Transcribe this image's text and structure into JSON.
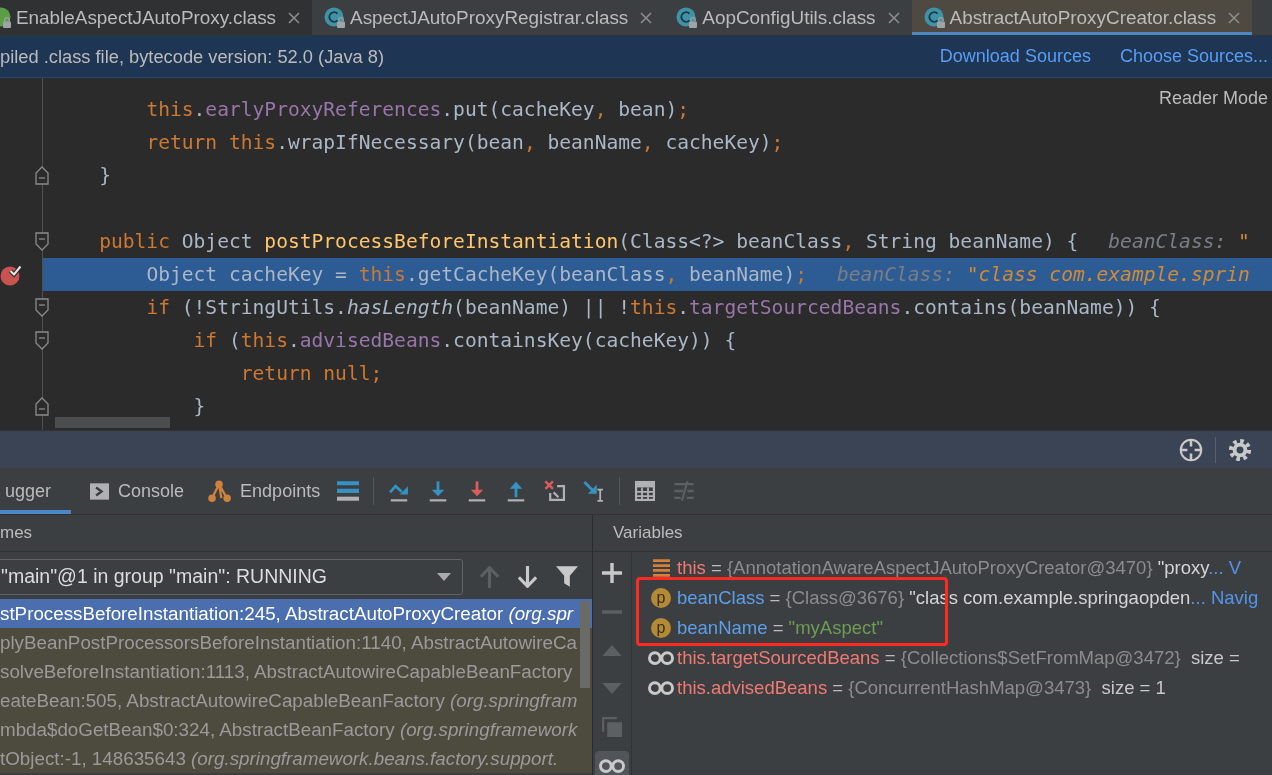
{
  "editor_tabs": [
    {
      "label": "EnableAspectJAutoProxy.class",
      "kind": "annotation",
      "selected": false,
      "hovered": true
    },
    {
      "label": "AspectJAutoProxyRegistrar.class",
      "kind": "class",
      "selected": false,
      "hovered": false
    },
    {
      "label": "AopConfigUtils.class",
      "kind": "class",
      "selected": false,
      "hovered": false
    },
    {
      "label": "AbstractAutoProxyCreator.class",
      "kind": "class",
      "selected": true,
      "hovered": false
    }
  ],
  "banner": {
    "message": "piled .class file, bytecode version: 52.0 (Java 8)",
    "links": [
      "Download Sources",
      "Choose Sources..."
    ]
  },
  "editor": {
    "reader_mode": "Reader Mode",
    "lines": [
      {
        "breakpoint": false,
        "current": false,
        "fold_start": false,
        "fold_end": false,
        "tokens": [
          {
            "text": "        this",
            "kind": "keyword"
          },
          {
            "text": ".earlyProxyReferences",
            "kind": "member"
          },
          {
            "text": ".put(cacheKey",
            "kind": "plain"
          },
          {
            "text": ", ",
            "kind": "separator"
          },
          {
            "text": "bean)",
            "kind": "plain"
          },
          {
            "text": ";",
            "kind": "separator"
          }
        ]
      },
      {
        "breakpoint": false,
        "current": false,
        "fold_start": false,
        "fold_end": false,
        "tokens": [
          {
            "text": "        return this",
            "kind": "keyword"
          },
          {
            "text": ".wrapIfNecessary(bean",
            "kind": "plain"
          },
          {
            "text": ", ",
            "kind": "separator"
          },
          {
            "text": "beanName",
            "kind": "plain"
          },
          {
            "text": ", ",
            "kind": "separator"
          },
          {
            "text": "cacheKey)",
            "kind": "plain"
          },
          {
            "text": ";",
            "kind": "separator"
          }
        ]
      },
      {
        "breakpoint": false,
        "current": false,
        "fold_start": false,
        "fold_end": true,
        "tokens": [
          {
            "text": "    }",
            "kind": "plain"
          }
        ]
      },
      {
        "breakpoint": false,
        "current": false,
        "fold_start": false,
        "fold_end": false
      },
      {
        "breakpoint": false,
        "current": false,
        "fold_start": true,
        "fold_end": false,
        "tokens": [
          {
            "text": "    public ",
            "kind": "keyword"
          },
          {
            "text": "Object ",
            "kind": "plain"
          },
          {
            "text": "postProcessBeforeInstantiation",
            "kind": "declaration"
          },
          {
            "text": "(Class<?> beanClass",
            "kind": "plain"
          },
          {
            "text": ", ",
            "kind": "separator"
          },
          {
            "text": "String beanName) {",
            "kind": "plain"
          }
        ],
        "hint": [
          {
            "text": "beanClass: ",
            "kind": "name"
          },
          {
            "text": "\"",
            "kind": "value"
          }
        ]
      },
      {
        "breakpoint": true,
        "current": true,
        "fold_start": false,
        "fold_end": false,
        "tokens": [
          {
            "text": "        Object cacheKey = ",
            "kind": "plain"
          },
          {
            "text": "this",
            "kind": "keyword"
          },
          {
            "text": ".getCacheKey(beanClass",
            "kind": "plain"
          },
          {
            "text": ", ",
            "kind": "separator"
          },
          {
            "text": "beanName)",
            "kind": "plain"
          },
          {
            "text": ";",
            "kind": "separator"
          }
        ],
        "hint": [
          {
            "text": "beanClass: ",
            "kind": "name"
          },
          {
            "text": "\"class com.example.sprin",
            "kind": "value"
          }
        ]
      },
      {
        "breakpoint": false,
        "current": false,
        "fold_start": true,
        "fold_end": false,
        "tokens": [
          {
            "text": "        if ",
            "kind": "keyword"
          },
          {
            "text": "(!StringUtils.",
            "kind": "plain"
          },
          {
            "text": "hasLength",
            "kind": "static"
          },
          {
            "text": "(beanName) || !",
            "kind": "plain"
          },
          {
            "text": "this",
            "kind": "keyword"
          },
          {
            "text": ".targetSourcedBeans",
            "kind": "member"
          },
          {
            "text": ".contains(beanName)) {",
            "kind": "plain"
          }
        ]
      },
      {
        "breakpoint": false,
        "current": false,
        "fold_start": true,
        "fold_end": false,
        "tokens": [
          {
            "text": "            if ",
            "kind": "keyword"
          },
          {
            "text": "(",
            "kind": "plain"
          },
          {
            "text": "this",
            "kind": "keyword"
          },
          {
            "text": ".advisedBeans",
            "kind": "member"
          },
          {
            "text": ".containsKey(cacheKey)) {",
            "kind": "plain"
          }
        ]
      },
      {
        "breakpoint": false,
        "current": false,
        "fold_start": false,
        "fold_end": false,
        "tokens": [
          {
            "text": "                return null",
            "kind": "keyword"
          },
          {
            "text": ";",
            "kind": "separator"
          }
        ]
      },
      {
        "breakpoint": false,
        "current": false,
        "fold_start": false,
        "fold_end": true,
        "tokens": [
          {
            "text": "            }",
            "kind": "plain"
          }
        ]
      }
    ]
  },
  "debug_window": {
    "actions": [
      {
        "kind": "crosshair"
      },
      {
        "kind": "settings"
      }
    ],
    "tabs": [
      {
        "label": "ugger",
        "kind": "plain",
        "selected": true
      },
      {
        "label": "Console",
        "kind": "console",
        "selected": false
      },
      {
        "label": "Endpoints",
        "kind": "endpoints",
        "selected": false
      }
    ],
    "toolbar": [
      [
        {
          "kind": "execution-point",
          "disabled": false
        }
      ],
      [
        {
          "kind": "step-over",
          "disabled": false
        },
        {
          "kind": "step-into",
          "disabled": false
        },
        {
          "kind": "force-step-into",
          "disabled": false
        },
        {
          "kind": "step-out",
          "disabled": false
        },
        {
          "kind": "drop-frame",
          "disabled": false
        },
        {
          "kind": "run-to-cursor",
          "disabled": false
        }
      ],
      [
        {
          "kind": "evaluate",
          "disabled": false
        },
        {
          "kind": "trace",
          "disabled": true
        }
      ]
    ],
    "frames": {
      "title": "mes",
      "thread": "\"main\"@1 in group \"main\": RUNNING",
      "actions": [
        {
          "kind": "previous",
          "disabled": true
        },
        {
          "kind": "next",
          "disabled": false
        },
        {
          "kind": "filter",
          "disabled": false
        }
      ],
      "items": [
        {
          "method": "stProcessBeforeInstantiation:245, AbstractAutoProxyCreator",
          "package": "(org.spr",
          "selected": true
        },
        {
          "method": "plyBeanPostProcessorsBeforeInstantiation:1140, AbstractAutowireCa",
          "selected": false
        },
        {
          "method": "solveBeforeInstantiation:1113, AbstractAutowireCapableBeanFactory",
          "selected": false
        },
        {
          "method": "eateBean:505, AbstractAutowireCapableBeanFactory",
          "package": "(org.springfram",
          "selected": false
        },
        {
          "method": "mbda$doGetBean$0:324, AbstractBeanFactory",
          "package": "(org.springframework",
          "selected": false
        },
        {
          "method": "tObject:-1, 148635643",
          "package": "(org.springframework.beans.factory.support.",
          "selected": false
        }
      ]
    },
    "variables": {
      "title": "Variables",
      "actions": [
        {
          "kind": "add",
          "disabled": false,
          "selected": false
        },
        {
          "kind": "remove",
          "disabled": true,
          "selected": false
        },
        {
          "kind": "move-up",
          "disabled": true,
          "selected": false
        },
        {
          "kind": "move-down",
          "disabled": true,
          "selected": false
        },
        {
          "kind": "copy",
          "disabled": true,
          "selected": false
        },
        {
          "kind": "watches",
          "disabled": false,
          "selected": true
        }
      ],
      "items": [
        {
          "kind": "this",
          "name": "this",
          "sign": "=",
          "reference": "{AnnotationAwareAspectJAutoProxyCreator@3470}",
          "value": "\"proxy",
          "ellipsis": "...",
          "link": "V",
          "highlighted": false
        },
        {
          "kind": "parameter",
          "badge": "p",
          "name": "beanClass",
          "sign": "=",
          "reference": "{Class@3676}",
          "value": "\"class com.example.springaopden",
          "ellipsis": "...",
          "link": "Navig",
          "highlighted": true
        },
        {
          "kind": "parameter",
          "badge": "p",
          "name": "beanName",
          "sign": "=",
          "string": "\"myAspect\"",
          "highlighted": true
        },
        {
          "kind": "watch",
          "name": "this.targetSourcedBeans",
          "sign": "=",
          "reference": "{Collections$SetFromMap@3472}",
          "size": "size =",
          "highlighted": false
        },
        {
          "kind": "watch",
          "name": "this.advisedBeans",
          "sign": "=",
          "reference": "{ConcurrentHashMap@3473}",
          "size": "size = 1",
          "highlighted": false
        }
      ]
    }
  }
}
